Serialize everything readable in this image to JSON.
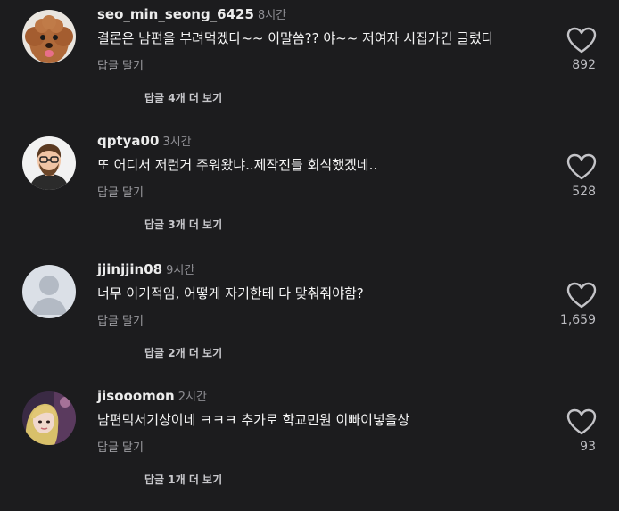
{
  "comments": [
    {
      "username": "seo_min_seong_6425",
      "time": "8시간",
      "text": "결론은 남편을 부려먹겠다~~ 이말씀?? 야~~ 저여자 시집가긴 글렀다",
      "reply_label": "답글 달기",
      "like_count": "892",
      "more_replies": "답글 4개 더 보기",
      "avatar_icon": "dog-photo-avatar-icon"
    },
    {
      "username": "qptya00",
      "time": "3시간",
      "text": "또 어디서 저런거 주워왔냐..제작진들 회식했겠네..",
      "reply_label": "답글 달기",
      "like_count": "528",
      "more_replies": "답글 3개 더 보기",
      "avatar_icon": "cartoon-man-avatar-icon"
    },
    {
      "username": "jjinjjin08",
      "time": "9시간",
      "text": "너무 이기적임, 어떻게 자기한테 다 맞춰줘야함?",
      "reply_label": "답글 달기",
      "like_count": "1,659",
      "more_replies": "답글 2개 더 보기",
      "avatar_icon": "default-user-avatar-icon"
    },
    {
      "username": "jisooomon",
      "time": "2시간",
      "text": "남편믹서기상이네 ㅋㅋㅋ 추가로 학교민원 이빠이넣을상",
      "reply_label": "답글 달기",
      "like_count": "93",
      "more_replies": "답글 1개 더 보기",
      "avatar_icon": "selfie-photo-avatar-icon"
    }
  ],
  "colors": {
    "background": "#1c1c1e",
    "text": "#f5f5f5",
    "muted": "#8e8e93"
  },
  "icons": {
    "like": "heart-outline-icon"
  }
}
